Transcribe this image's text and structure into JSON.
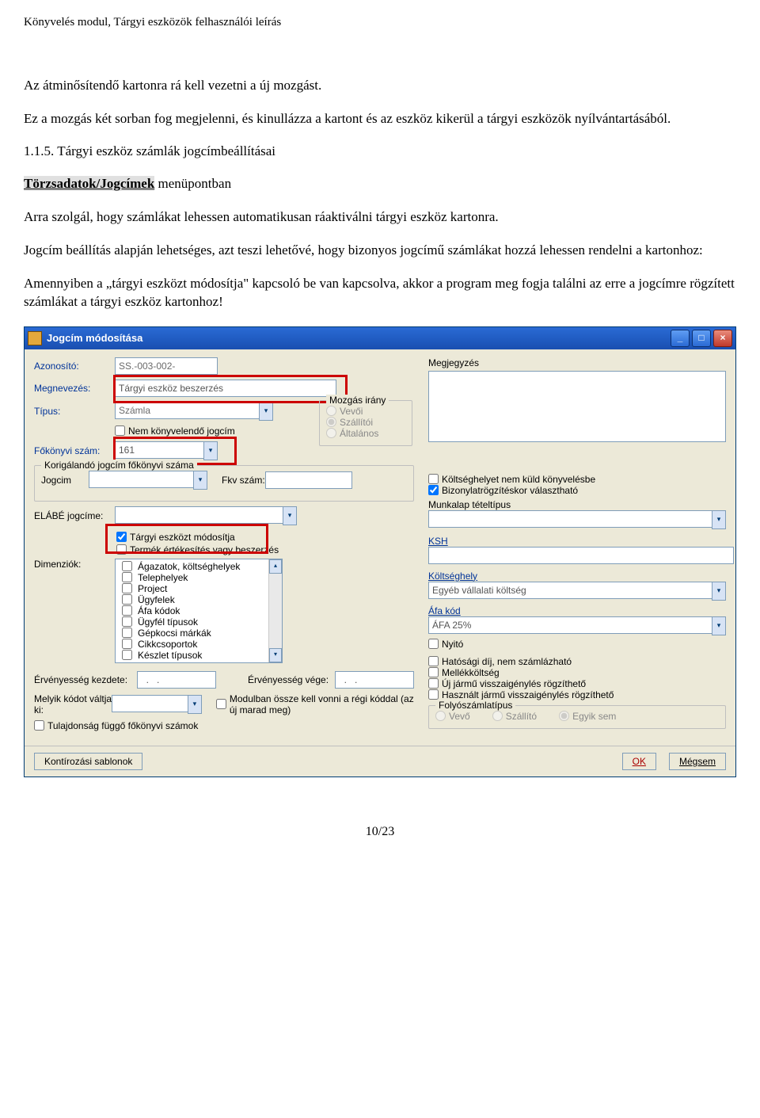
{
  "doc": {
    "header": "Könyvelés modul, Tárgyi eszközök felhasználói leírás",
    "para1": "Az átminősítendő kartonra rá kell vezetni a új mozgást.",
    "para2": "Ez a mozgás két sorban fog megjelenni, és kinullázza a kartont és az eszköz kikerül a tárgyi eszközök nyílvántartásából.",
    "sec_num": "1.1.5. Tárgyi eszköz számlák jogcímbeállításai",
    "menu_path_strong": "Törzsadatok/Jogcímek",
    "menu_path_tail": " menüpontban",
    "para3": "Arra szolgál, hogy számlákat lehessen automatikusan ráaktiválni tárgyi eszköz kartonra.",
    "para4": "Jogcím beállítás alapján lehetséges, azt teszi lehetővé, hogy bizonyos jogcímű számlákat hozzá lehessen rendelni a kartonhoz:",
    "para5": "Amennyiben a „tárgyi eszközt módosítja\" kapcsoló be van kapcsolva, akkor a program meg fogja találni az erre a jogcímre rögzített számlákat a tárgyi eszköz kartonhoz!",
    "page_num": "10/23"
  },
  "window": {
    "title": "Jogcím módosítása",
    "labels": {
      "azonosito": "Azonosító:",
      "megnevezes": "Megnevezés:",
      "tipus": "Típus:",
      "fokonyvi": "Főkönyvi szám:",
      "nem_konyv": "Nem könyvelendő jogcím",
      "mozgas_irany": "Mozgás irány",
      "vevoi": "Vevői",
      "szallitoi": "Szállítói",
      "altalanos": "Általános",
      "korig": "Korigálandó jogcím főkönyvi száma",
      "jogcim": "Jogcim",
      "fkv_szam": "Fkv szám:",
      "elabe": "ELÁBÉ jogcíme:",
      "targyi_modosit": "Tárgyi eszközt módosítja",
      "termek": "Termék értékesítés vagy beszerzés",
      "dimenziok": "Dimenziók:",
      "erv_kezdete": "Érvényesség kezdete:",
      "erv_vege": "Érvényesség vége:",
      "melyik_kodot": "Melyik kódot váltja ki:",
      "modulban": "Modulban össze kell vonni a régi kóddal (az új marad meg)",
      "tulajdonsag": "Tulajdonság függő főkönyvi számok",
      "megjegyzes": "Megjegyzés",
      "koltseghely_nem": "Költséghelyet nem küld könyvelésbe",
      "bizonylat": "Bizonylatrögzítéskor választható",
      "munkalap": "Munkalap tételtípus",
      "ksh": "KSH",
      "koltseghely": "Költséghely",
      "afa_kod": "Áfa kód",
      "nyito": "Nyitó",
      "hatosagi": "Hatósági díj, nem számlázható",
      "mellekkoltseg": "Mellékköltség",
      "uj_jarmu": "Új jármű visszaigénylés rögzíthető",
      "hasznalt_jarmu": "Használt jármű visszaigénylés rögzíthető",
      "folyoszamla": "Folyószámlatípus",
      "fs_vevo": "Vevő",
      "fs_szallito": "Szállító",
      "fs_egyik": "Egyik sem",
      "kontirozasi": "Kontírozási sablonok",
      "ok": "OK",
      "megsem": "Mégsem"
    },
    "values": {
      "azonosito": "SS.-003-002-",
      "megnevezes": "Tárgyi eszköz beszerzés",
      "tipus": "Számla",
      "fokonyvi": "161",
      "koltseghely": "Egyéb vállalati költség",
      "afa_kod": "ÁFA 25%"
    },
    "dimenziok": [
      "Ágazatok, költséghelyek",
      "Telephelyek",
      "Project",
      "Ügyfelek",
      "Áfa kódok",
      "Ügyfél típusok",
      "Gépkocsi márkák",
      "Cikkcsoportok",
      "Készlet típusok"
    ]
  }
}
